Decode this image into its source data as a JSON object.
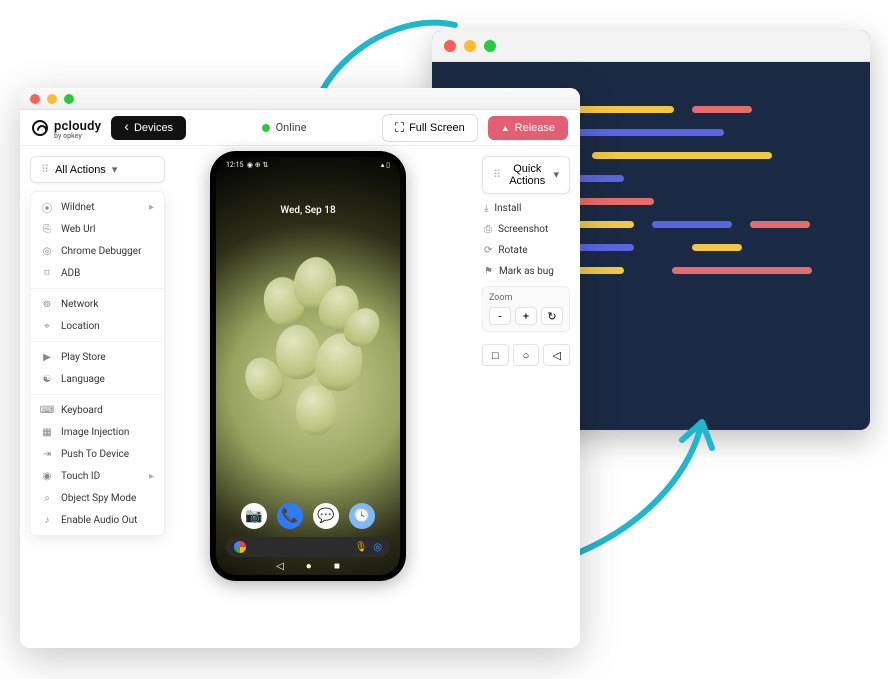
{
  "brand": {
    "name": "pcloudy",
    "sub": "by opkey"
  },
  "toolbar": {
    "devices_label": "Devices",
    "online_label": "Online",
    "fullscreen_label": "Full Screen",
    "release_label": "Release"
  },
  "left_panel": {
    "title": "All Actions",
    "items": [
      {
        "label": "Wildnet",
        "icon": "globe",
        "sub": true
      },
      {
        "label": "Web Url",
        "icon": "link"
      },
      {
        "label": "Chrome Debugger",
        "icon": "chrome"
      },
      {
        "label": "ADB",
        "icon": "terminal"
      },
      {
        "label": "Network",
        "icon": "wifi"
      },
      {
        "label": "Location",
        "icon": "pin"
      },
      {
        "label": "Play Store",
        "icon": "play"
      },
      {
        "label": "Language",
        "icon": "lang"
      },
      {
        "label": "Keyboard",
        "icon": "keyboard"
      },
      {
        "label": "Image Injection",
        "icon": "image"
      },
      {
        "label": "Push To Device",
        "icon": "push"
      },
      {
        "label": "Touch ID",
        "icon": "finger",
        "sub": true
      },
      {
        "label": "Object Spy Mode",
        "icon": "spy"
      },
      {
        "label": "Enable Audio Out",
        "icon": "audio"
      }
    ],
    "dividers_after": [
      3,
      5,
      7
    ]
  },
  "right_panel": {
    "title": "Quick Actions",
    "items": [
      {
        "label": "Install",
        "icon": "download"
      },
      {
        "label": "Screenshot",
        "icon": "camera"
      },
      {
        "label": "Rotate",
        "icon": "rotate"
      },
      {
        "label": "Mark as bug",
        "icon": "bug"
      }
    ],
    "zoom_label": "Zoom",
    "zoom_buttons": [
      "-",
      "+",
      "↻"
    ],
    "nav_buttons": [
      "□",
      "○",
      "◁"
    ]
  },
  "phone": {
    "time": "12:15",
    "status_icons": "◉ ⊕ ⇅",
    "right_icons": "▴ ▯",
    "date": "Wed, Sep 18",
    "dock": [
      "camera",
      "phone",
      "chat",
      "clock"
    ]
  },
  "icon_glyphs": {
    "globe": "⦿",
    "link": "⎘",
    "chrome": "◎",
    "terminal": "⌑",
    "wifi": "⊚",
    "pin": "⌖",
    "play": "▶",
    "lang": "☯",
    "keyboard": "⌨",
    "image": "▦",
    "push": "⇥",
    "finger": "◉",
    "spy": "⌕",
    "audio": "♪",
    "download": "⤓",
    "camera": "⎙",
    "rotate": "⟳",
    "bug": "⚑"
  }
}
